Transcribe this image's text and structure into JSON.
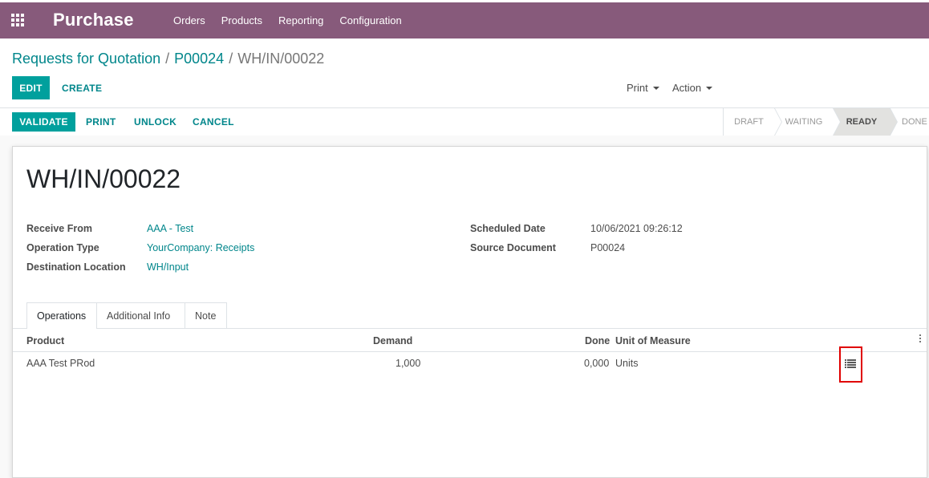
{
  "navbar": {
    "app_name": "Purchase",
    "menu": [
      "Orders",
      "Products",
      "Reporting",
      "Configuration"
    ]
  },
  "breadcrumb": {
    "items": [
      "Requests for Quotation",
      "P00024"
    ],
    "separator": "/",
    "current": "WH/IN/00022"
  },
  "controls": {
    "edit": "EDIT",
    "create": "CREATE",
    "print": "Print",
    "action": "Action"
  },
  "statusbar": {
    "buttons": [
      "VALIDATE",
      "PRINT",
      "UNLOCK",
      "CANCEL"
    ],
    "stages": [
      "DRAFT",
      "WAITING",
      "READY",
      "DONE"
    ],
    "active_stage": "READY"
  },
  "record": {
    "title": "WH/IN/00022",
    "receive_from_label": "Receive From",
    "receive_from": "AAA - Test",
    "operation_type_label": "Operation Type",
    "operation_type": "YourCompany: Receipts",
    "destination_label": "Destination Location",
    "destination": "WH/Input",
    "scheduled_date_label": "Scheduled Date",
    "scheduled_date": "10/06/2021 09:26:12",
    "source_document_label": "Source Document",
    "source_document": "P00024"
  },
  "tabs": [
    "Operations",
    "Additional Info",
    "Note"
  ],
  "active_tab": "Operations",
  "table": {
    "columns": [
      "Product",
      "Demand",
      "Done",
      "Unit of Measure"
    ],
    "rows": [
      {
        "product": "AAA Test PRod",
        "demand": "1,000",
        "done": "0,000",
        "uom": "Units"
      }
    ]
  },
  "colors": {
    "navbar": "#875a7b",
    "primary": "#00a09d",
    "link": "#00868b",
    "highlight_box": "#e00000"
  },
  "icons": [
    "apps-grid-icon",
    "caret-down-icon",
    "kebab-menu-icon",
    "list-detail-icon"
  ]
}
